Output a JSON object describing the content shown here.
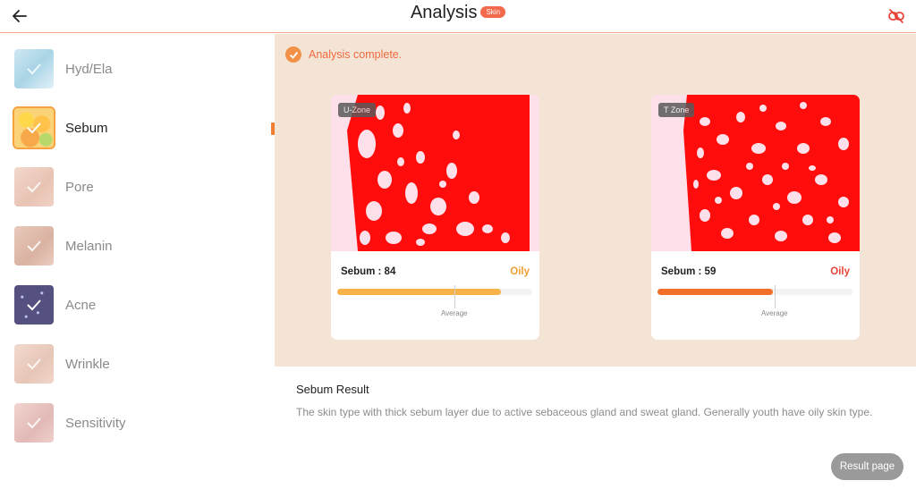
{
  "header": {
    "title": "Analysis",
    "badge": "Skin",
    "back_icon": "arrow-left-icon",
    "link_icon": "link-broken-icon",
    "accent_color": "#f26a4b"
  },
  "sidebar": {
    "items": [
      {
        "label": "Hyd/Ela",
        "icon": "hydration-thumbnail",
        "active": false
      },
      {
        "label": "Sebum",
        "icon": "sebum-thumbnail",
        "active": true
      },
      {
        "label": "Pore",
        "icon": "pore-thumbnail",
        "active": false
      },
      {
        "label": "Melanin",
        "icon": "melanin-thumbnail",
        "active": false
      },
      {
        "label": "Acne",
        "icon": "acne-thumbnail",
        "active": false
      },
      {
        "label": "Wrinkle",
        "icon": "wrinkle-thumbnail",
        "active": false
      },
      {
        "label": "Sensitivity",
        "icon": "sensitivity-thumbnail",
        "active": false
      }
    ]
  },
  "main": {
    "status": "Analysis complete.",
    "cards": [
      {
        "zone": "U-Zone",
        "score_label": "Sebum : 84",
        "value": 84,
        "type": "Oily",
        "type_color": "#f0a030",
        "bar_color": "#f7b24a",
        "average_label": "Average",
        "average": 60
      },
      {
        "zone": "T Zone",
        "score_label": "Sebum : 59",
        "value": 59,
        "type": "Oily",
        "type_color": "#e8443a",
        "bar_color": "#f26f2a",
        "average_label": "Average",
        "average": 60
      }
    ]
  },
  "result": {
    "title": "Sebum Result",
    "description": "The skin type with thick sebum layer due to active sebaceous gland and sweat gland. Generally youth have oily skin type.",
    "button": "Result page"
  }
}
